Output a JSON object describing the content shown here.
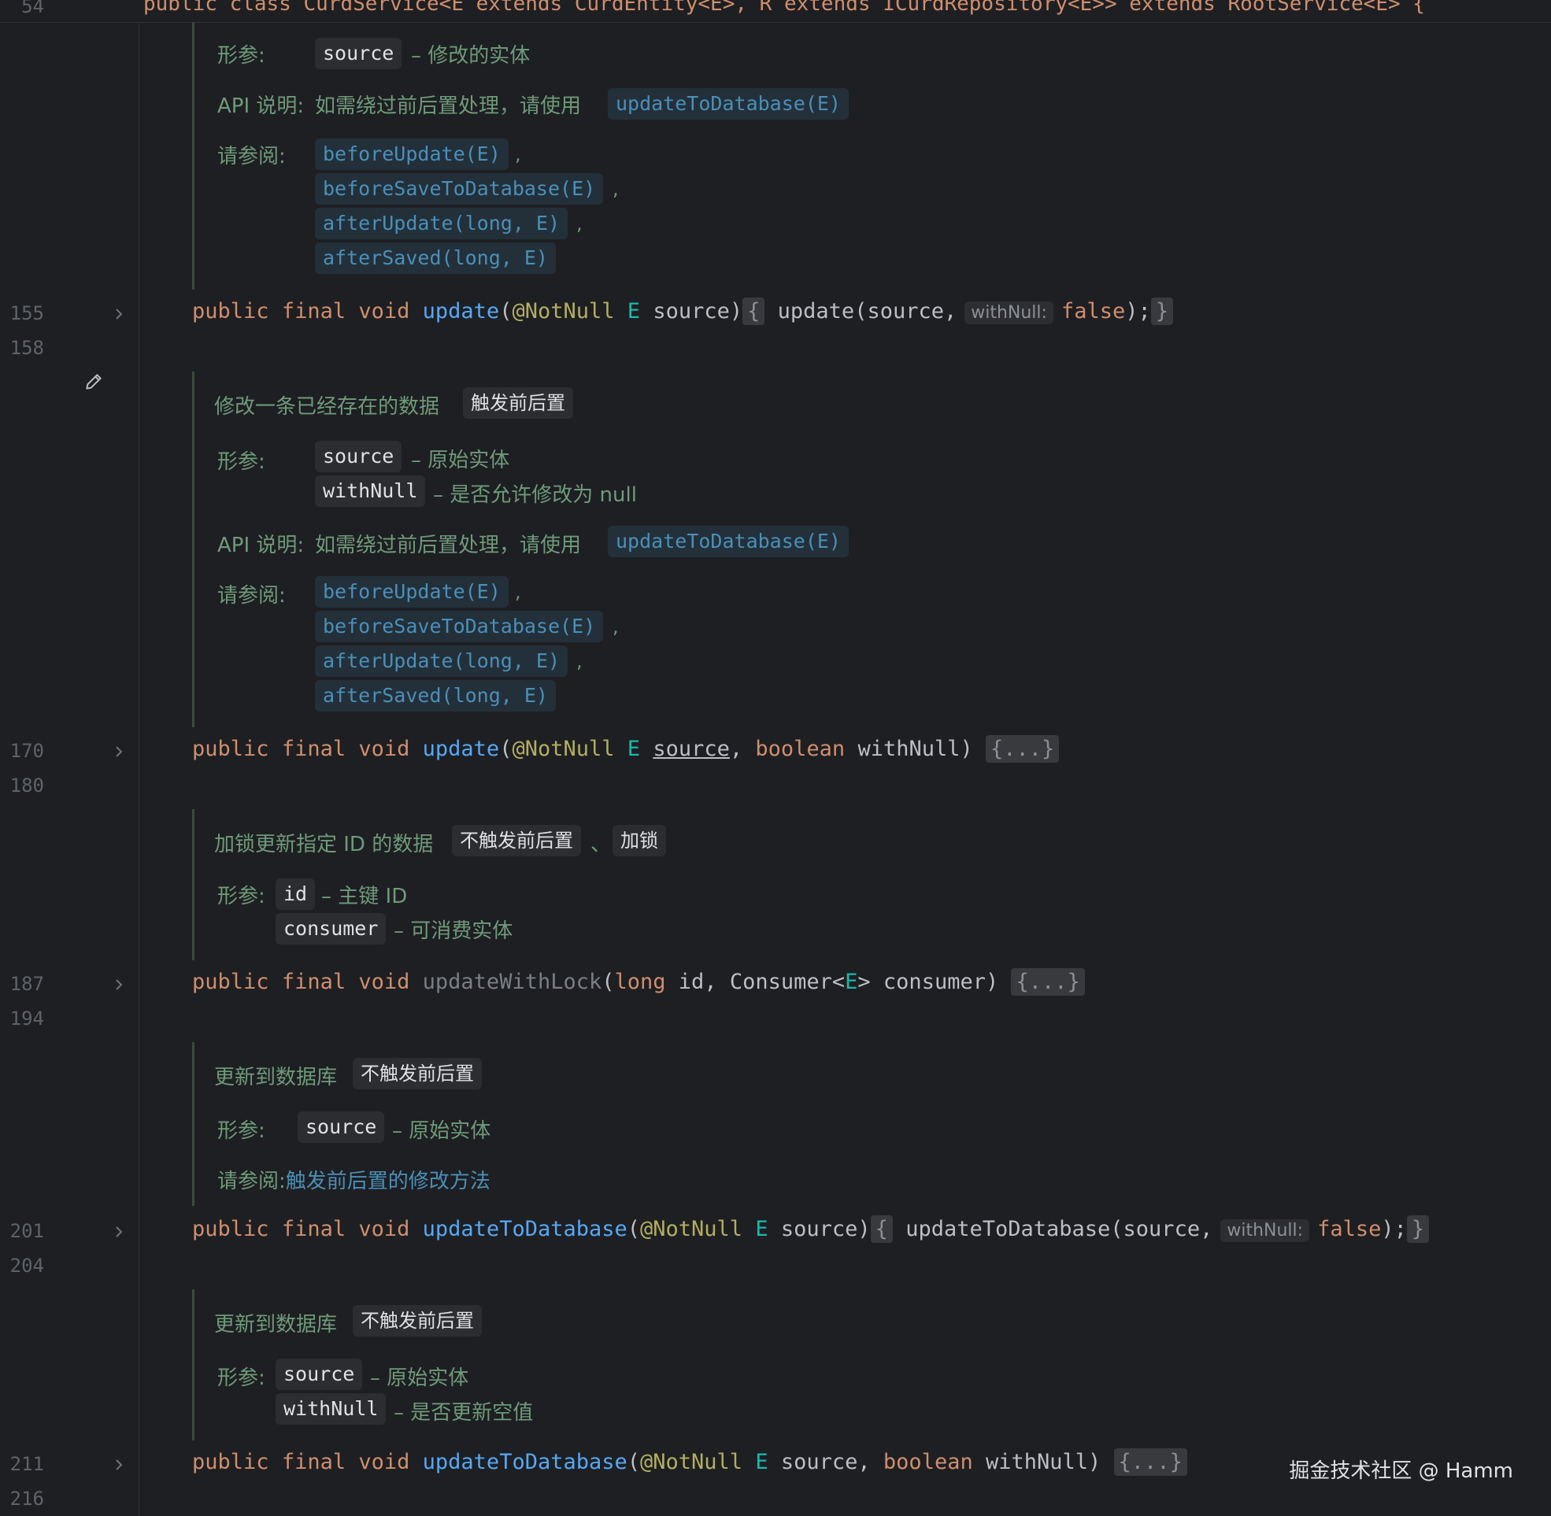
{
  "header_line": {
    "number": "54",
    "text": "public class CurdService<E extends CurdEntity<E>, R extends ICurdRepository<E>> extends RootService<E> {"
  },
  "docs": {
    "labels": {
      "params": "形参:",
      "api_note": "API 说明:",
      "see_also": "请参阅:"
    },
    "d1": {
      "param_source": "source",
      "param_source_desc": "– 修改的实体",
      "api_text": "如需绕过前后置处理，请使用",
      "api_link": "updateToDatabase(E)",
      "see": [
        "beforeUpdate(E)",
        "beforeSaveToDatabase(E)",
        "afterUpdate(long, E)",
        "afterSaved(long, E)"
      ]
    },
    "d2": {
      "summary": "修改一条已经存在的数据",
      "tag": "触发前后置",
      "param_source": "source",
      "param_source_desc": "– 原始实体",
      "param_withnull": "withNull",
      "param_withnull_desc": "– 是否允许修改为 null",
      "api_text": "如需绕过前后置处理，请使用",
      "api_link": "updateToDatabase(E)",
      "see": [
        "beforeUpdate(E)",
        "beforeSaveToDatabase(E)",
        "afterUpdate(long, E)",
        "afterSaved(long, E)"
      ]
    },
    "d3": {
      "summary": "加锁更新指定 ID 的数据",
      "tag1": "不触发前后置",
      "sep": "、",
      "tag2": "加锁",
      "param_id": "id",
      "param_id_desc": "– 主键 ID",
      "param_consumer": "consumer",
      "param_consumer_desc": "– 可消费实体"
    },
    "d4": {
      "summary": "更新到数据库",
      "tag": "不触发前后置",
      "param_source": "source",
      "param_source_desc": "– 原始实体",
      "see_link": "触发前后置的修改方法"
    },
    "d5": {
      "summary": "更新到数据库",
      "tag": "不触发前后置",
      "param_source": "source",
      "param_source_desc": "– 原始实体",
      "param_withnull": "withNull",
      "param_withnull_desc": "– 是否更新空值"
    }
  },
  "code_lines": {
    "l155": {
      "num": "155",
      "after": "158",
      "kw1": "public",
      "kw2": "final",
      "kw3": "void",
      "name": "update",
      "ann": "@NotNull",
      "type": "E",
      "param": "source",
      "body": "update(source,",
      "hint": "withNull:",
      "val": "false",
      "tail": ");"
    },
    "l170": {
      "num": "170",
      "after": "180",
      "kw1": "public",
      "kw2": "final",
      "kw3": "void",
      "name": "update",
      "ann": "@NotNull",
      "type": "E",
      "param": "source",
      "kw4": "boolean",
      "param2": "withNull",
      "fold": "{...}"
    },
    "l187": {
      "num": "187",
      "after": "194",
      "kw1": "public",
      "kw2": "final",
      "kw3": "void",
      "name": "updateWithLock",
      "kw4": "long",
      "param": "id",
      "ctype": "Consumer",
      "type": "E",
      "param2": "consumer",
      "fold": "{...}"
    },
    "l201": {
      "num": "201",
      "after": "204",
      "kw1": "public",
      "kw2": "final",
      "kw3": "void",
      "name": "updateToDatabase",
      "ann": "@NotNull",
      "type": "E",
      "param": "source",
      "body": "updateToDatabase(source,",
      "hint": "withNull:",
      "val": "false",
      "tail": ");"
    },
    "l211": {
      "num": "211",
      "after": "216",
      "kw1": "public",
      "kw2": "final",
      "kw3": "void",
      "name": "updateToDatabase",
      "ann": "@NotNull",
      "type": "E",
      "param": "source",
      "kw4": "boolean",
      "param2": "withNull",
      "fold": "{...}"
    }
  },
  "watermark": "掘金技术社区 @ Hamm",
  "colors": {
    "background": "#1e1f22",
    "keyword": "#cf8e6d",
    "function": "#56a8f5",
    "annotation": "#b3ae60",
    "type_param": "#16baac",
    "doc_text": "#6e9a7a",
    "doc_link": "#4a8fb8"
  }
}
